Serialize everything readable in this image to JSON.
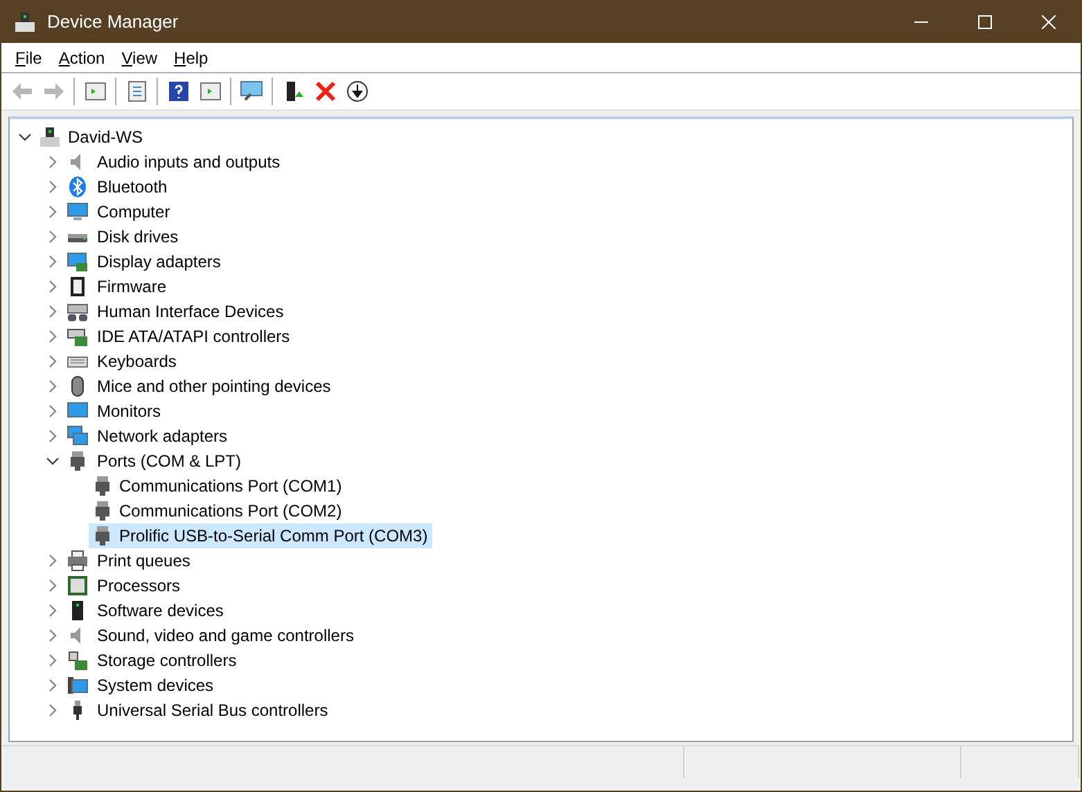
{
  "window": {
    "title": "Device Manager"
  },
  "menu": [
    {
      "label": "File"
    },
    {
      "label": "Action"
    },
    {
      "label": "View"
    },
    {
      "label": "Help"
    }
  ],
  "tree": {
    "label": "David-WS",
    "expanded": true,
    "children": [
      {
        "label": "Audio inputs and outputs",
        "expanded": false,
        "selected": false
      },
      {
        "label": "Bluetooth",
        "expanded": false,
        "selected": false
      },
      {
        "label": "Computer",
        "expanded": false,
        "selected": false
      },
      {
        "label": "Disk drives",
        "expanded": false,
        "selected": false
      },
      {
        "label": "Display adapters",
        "expanded": false,
        "selected": false
      },
      {
        "label": "Firmware",
        "expanded": false,
        "selected": false
      },
      {
        "label": "Human Interface Devices",
        "expanded": false,
        "selected": false
      },
      {
        "label": "IDE ATA/ATAPI controllers",
        "expanded": false,
        "selected": false
      },
      {
        "label": "Keyboards",
        "expanded": false,
        "selected": false
      },
      {
        "label": "Mice and other pointing devices",
        "expanded": false,
        "selected": false
      },
      {
        "label": "Monitors",
        "expanded": false,
        "selected": false
      },
      {
        "label": "Network adapters",
        "expanded": false,
        "selected": false
      },
      {
        "label": "Ports (COM & LPT)",
        "expanded": true,
        "selected": false,
        "children": [
          {
            "label": "Communications Port (COM1)",
            "selected": false
          },
          {
            "label": "Communications Port (COM2)",
            "selected": false
          },
          {
            "label": "Prolific USB-to-Serial Comm Port (COM3)",
            "selected": true
          }
        ]
      },
      {
        "label": "Print queues",
        "expanded": false,
        "selected": false
      },
      {
        "label": "Processors",
        "expanded": false,
        "selected": false
      },
      {
        "label": "Software devices",
        "expanded": false,
        "selected": false
      },
      {
        "label": "Sound, video and game controllers",
        "expanded": false,
        "selected": false
      },
      {
        "label": "Storage controllers",
        "expanded": false,
        "selected": false
      },
      {
        "label": "System devices",
        "expanded": false,
        "selected": false
      },
      {
        "label": "Universal Serial Bus controllers",
        "expanded": false,
        "selected": false
      }
    ]
  }
}
